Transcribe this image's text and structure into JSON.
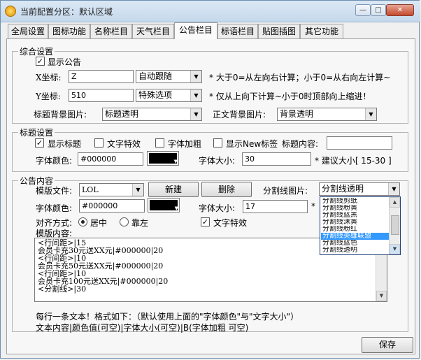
{
  "window": {
    "title": "当前配置分区：默认区域"
  },
  "tabs": [
    "全局设置",
    "图标功能",
    "名称栏目",
    "天气栏目",
    "公告栏目",
    "标语栏目",
    "贴图插图",
    "其它功能"
  ],
  "general": {
    "legend": "综合设置",
    "show_notice": "显示公告",
    "x_label": "X坐标:",
    "x_value": "Z",
    "x_mode": "自动跟随",
    "x_hint": "* 大于0=从左向右计算；小于0=从右向左计算~",
    "y_label": "Y坐标:",
    "y_value": "510",
    "y_mode": "特殊选项",
    "y_hint": "* 仅从上向下计算~小于0时顶部向上缩进！",
    "title_bg_label": "标题背景图片:",
    "title_bg_value": "标题透明",
    "body_bg_label": "正文背景图片:",
    "body_bg_value": "背景透明"
  },
  "title_settings": {
    "legend": "标题设置",
    "show_title": "显示标题",
    "text_effect": "文字特效",
    "font_bold": "字体加粗",
    "show_new_tag": "显示New标签",
    "content_label": "标题内容:",
    "content_value": "",
    "color_label": "字体颜色:",
    "color_value": "#000000",
    "color_swatch": "#000000",
    "size_label": "字体大小:",
    "size_value": "30",
    "size_hint": "* 建议大小[ 15-30 ]"
  },
  "notice": {
    "legend": "公告内容",
    "template_label": "模版文件:",
    "template_value": "LOL",
    "new_button": "新建",
    "delete_button": "删除",
    "divider_label": "分割线图片:",
    "divider_value": "分割线透明",
    "color_label": "字体颜色:",
    "color_value": "#000000",
    "color_swatch": "#000000",
    "size_label": "字体大小:",
    "size_value": "17",
    "size_star": "*",
    "align_label": "对齐方式:",
    "align_center": "居中",
    "align_left": "靠左",
    "text_effect": "文字特效",
    "content_label": "模版内容:",
    "content_lines": [
      "<行间距>|15",
      "会员卡充30元送XX元|#000000|20",
      "<行间距>|10",
      "会员卡充50元送XX元|#000000|20",
      "<行间距>|10",
      "会员卡充100元送XX元|#000000|20",
      "<分割线>|30"
    ],
    "dropdown_options": [
      "分割线剪纸",
      "分割线粉黄",
      "分割线蓝黑",
      "分割线沫黄",
      "分割线粉红",
      "分割线英雄联盟",
      "分割线蓝色",
      "分割线透明"
    ],
    "dropdown_selected_index": 5,
    "help_line1": "每行一条文本！格式如下：（默认使用上面的\"字体颜色\"与\"文字大小\"）",
    "help_line2": "文本内容|颜色值(可空)|字体大小(可空)|B(字体加粗 可空)"
  },
  "save_button": "保存",
  "colors": {
    "selection": "#3399ff",
    "titlebar": "#c5d8ec"
  }
}
